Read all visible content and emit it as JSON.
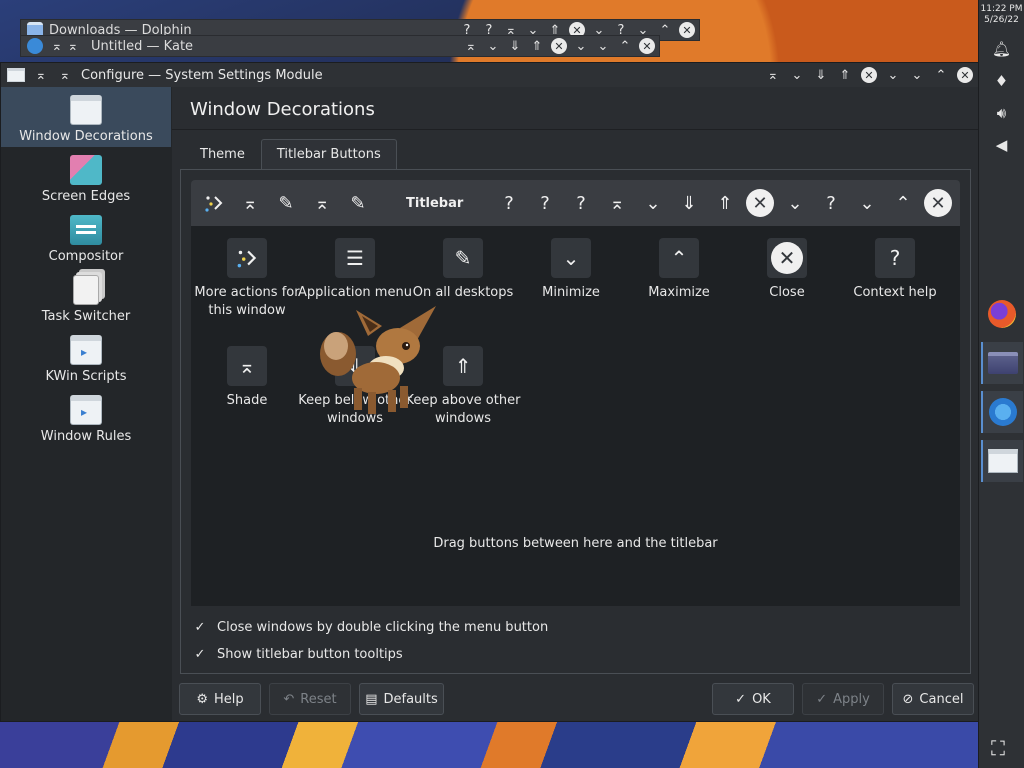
{
  "background_windows": [
    {
      "title": "Downloads — Dolphin"
    },
    {
      "title": "Untitled — Kate"
    }
  ],
  "window": {
    "title": "Configure — System Settings Module"
  },
  "sidebar": {
    "items": [
      {
        "label": "Window Decorations",
        "icon": "window-icon",
        "active": true
      },
      {
        "label": "Screen Edges",
        "icon": "screen-edges-icon"
      },
      {
        "label": "Compositor",
        "icon": "compositor-icon"
      },
      {
        "label": "Task Switcher",
        "icon": "task-switcher-icon"
      },
      {
        "label": "KWin Scripts",
        "icon": "kwin-scripts-icon"
      },
      {
        "label": "Window Rules",
        "icon": "window-rules-icon"
      }
    ]
  },
  "page": {
    "title": "Window Decorations",
    "tabs": [
      {
        "label": "Theme"
      },
      {
        "label": "Titlebar Buttons",
        "active": true
      }
    ]
  },
  "preview": {
    "title": "Titlebar"
  },
  "pool": {
    "items": [
      {
        "label": "More actions for this window",
        "icon": "more-actions-icon"
      },
      {
        "label": "Application menu",
        "icon": "hamburger-menu-icon"
      },
      {
        "label": "On all desktops",
        "icon": "pin-icon"
      },
      {
        "label": "Minimize",
        "icon": "chevron-down-icon"
      },
      {
        "label": "Maximize",
        "icon": "chevron-up-icon"
      },
      {
        "label": "Close",
        "icon": "close-icon"
      },
      {
        "label": "Context help",
        "icon": "question-icon"
      },
      {
        "label": "Shade",
        "icon": "shade-icon"
      },
      {
        "label": "Keep below other windows",
        "icon": "keep-below-icon"
      },
      {
        "label": "Keep above other windows",
        "icon": "keep-above-icon"
      }
    ],
    "hint": "Drag buttons between here and the titlebar"
  },
  "options": {
    "close_double_click": {
      "label": "Close windows by double clicking the menu button",
      "checked": true
    },
    "show_tooltips": {
      "label": "Show titlebar button tooltips",
      "checked": true
    }
  },
  "footer": {
    "help": "Help",
    "reset": "Reset",
    "defaults": "Defaults",
    "ok": "OK",
    "apply": "Apply",
    "cancel": "Cancel"
  },
  "panel": {
    "time": "11:22 PM",
    "date": "5/26/22"
  }
}
